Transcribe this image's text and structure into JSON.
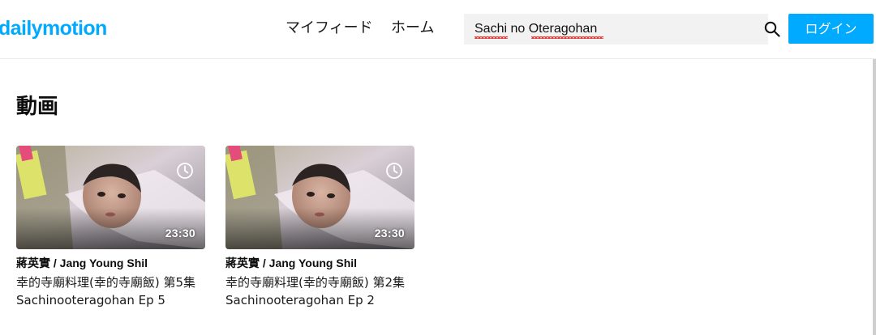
{
  "header": {
    "logo": "dailymotion",
    "nav": {
      "feed": "マイフィード",
      "home": "ホーム"
    },
    "search": {
      "value": "Sachi no Oteragohan"
    },
    "login_label": "ログイン"
  },
  "main": {
    "section_title": "動画",
    "videos": [
      {
        "owner": "蔣英實 / Jang Young Shil",
        "title": "幸的寺廟料理(幸的寺廟飯) 第5集 Sachinooteragohan Ep 5",
        "duration": "23:30"
      },
      {
        "owner": "蔣英實 / Jang Young Shil",
        "title": "幸的寺廟料理(幸的寺廟飯) 第2集 Sachinooteragohan Ep 2",
        "duration": "23:30"
      }
    ]
  },
  "colors": {
    "brand": "#00aaff",
    "search_bg": "#f2f2f2"
  },
  "icons": {
    "search": "search-icon",
    "watch_later": "clock-icon"
  }
}
